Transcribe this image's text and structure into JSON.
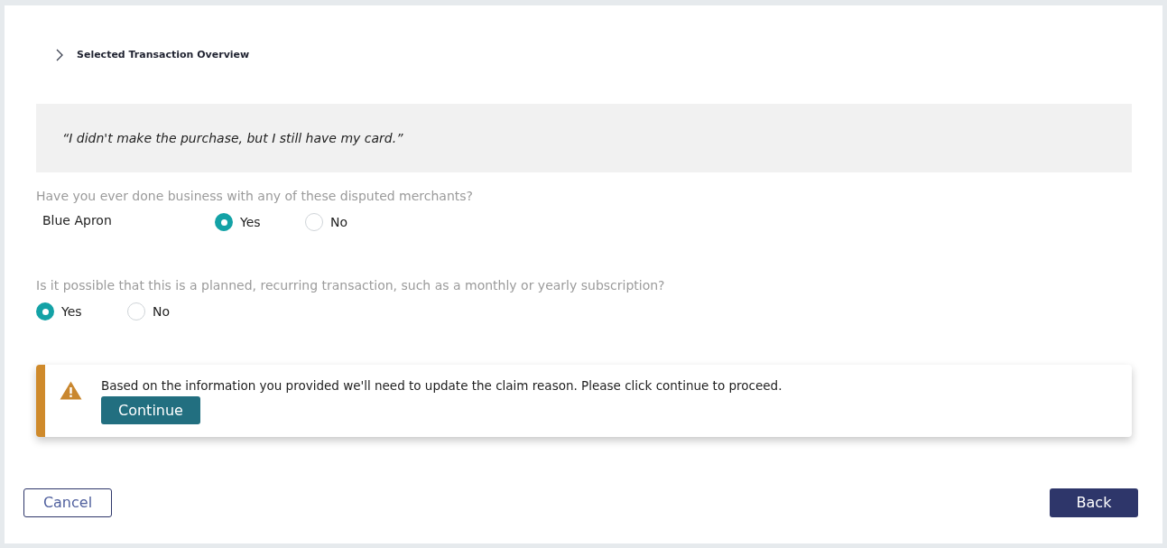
{
  "overview": {
    "title": "Selected Transaction Overview",
    "expanded": false
  },
  "quote": "“I didn't make the purchase, but I still have my card.”",
  "questions": [
    {
      "kind": "merchant",
      "prompt": "Have you ever done business with any of these disputed merchants?",
      "rows": [
        {
          "merchant": "Blue Apron",
          "options": [
            {
              "label": "Yes",
              "selected": true
            },
            {
              "label": "No",
              "selected": false
            }
          ]
        }
      ]
    },
    {
      "kind": "plain",
      "prompt": "Is it possible that this is a planned, recurring transaction, such as a monthly or yearly subscription?",
      "options": [
        {
          "label": "Yes",
          "selected": true
        },
        {
          "label": "No",
          "selected": false
        }
      ]
    }
  ],
  "alert": {
    "kind": "warning",
    "message": "Based on the information you provided we'll need to update the claim reason. Please click continue to proceed.",
    "action": "Continue"
  },
  "buttons": [
    {
      "label": "Cancel",
      "kind": "secondary"
    },
    {
      "label": "Back",
      "kind": "primary"
    }
  ]
}
